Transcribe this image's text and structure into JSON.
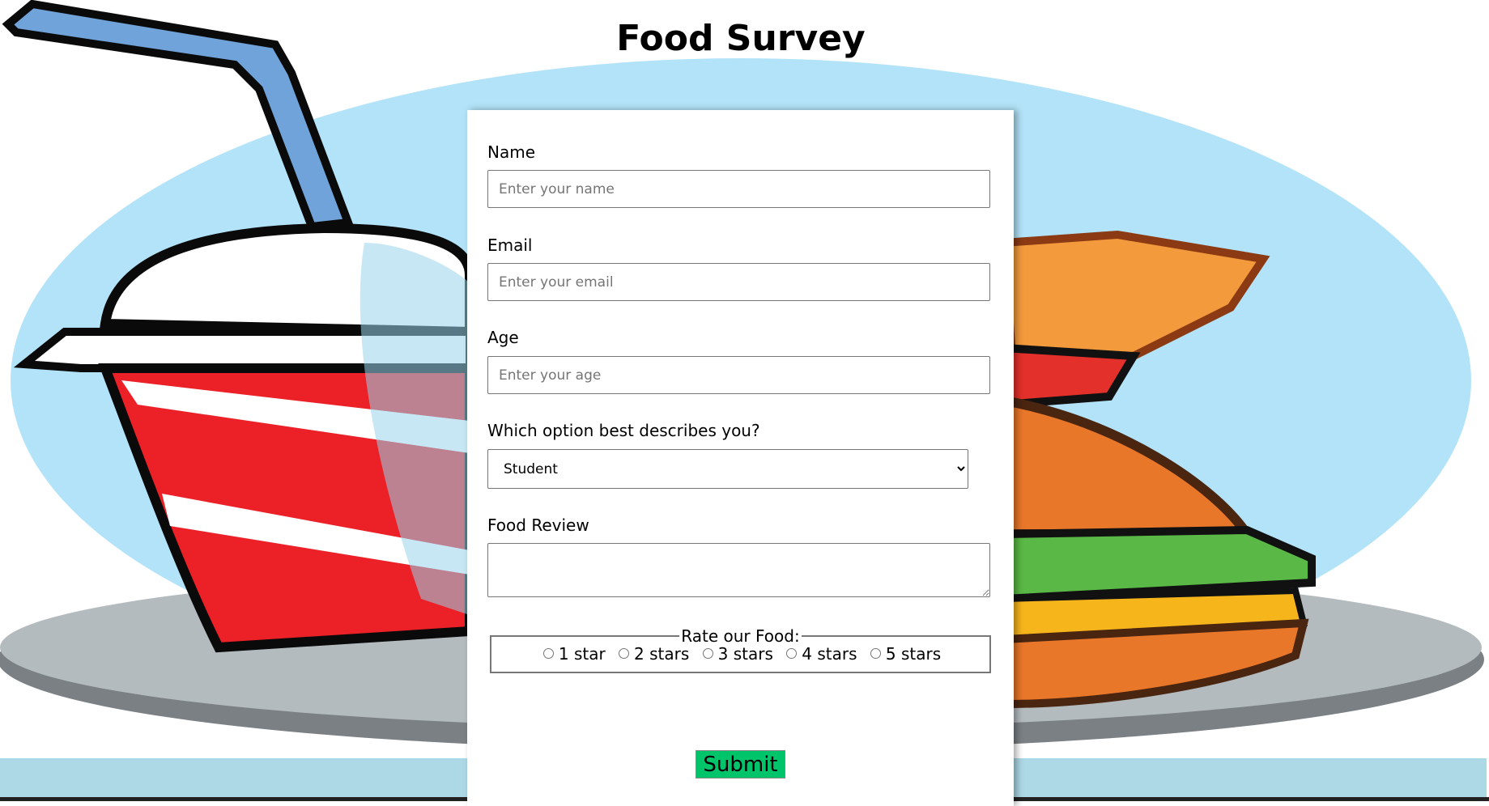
{
  "page": {
    "title": "Food Survey"
  },
  "form": {
    "name": {
      "label": "Name",
      "placeholder": "Enter your name",
      "value": ""
    },
    "email": {
      "label": "Email",
      "placeholder": "Enter your email",
      "value": ""
    },
    "age": {
      "label": "Age",
      "placeholder": "Enter your age",
      "value": ""
    },
    "role": {
      "label": "Which option best describes you?",
      "selected": "Student"
    },
    "review": {
      "label": "Food Review",
      "value": ""
    },
    "rating": {
      "legend": "Rate our Food:",
      "options": [
        "1 star",
        "2 stars",
        "3 stars",
        "4 stars",
        "5 stars"
      ],
      "selected": null
    },
    "submit_label": "Submit"
  },
  "colors": {
    "submit": "#00c46a",
    "band": "#add8e6",
    "ellipse": "#b3e3f8"
  }
}
